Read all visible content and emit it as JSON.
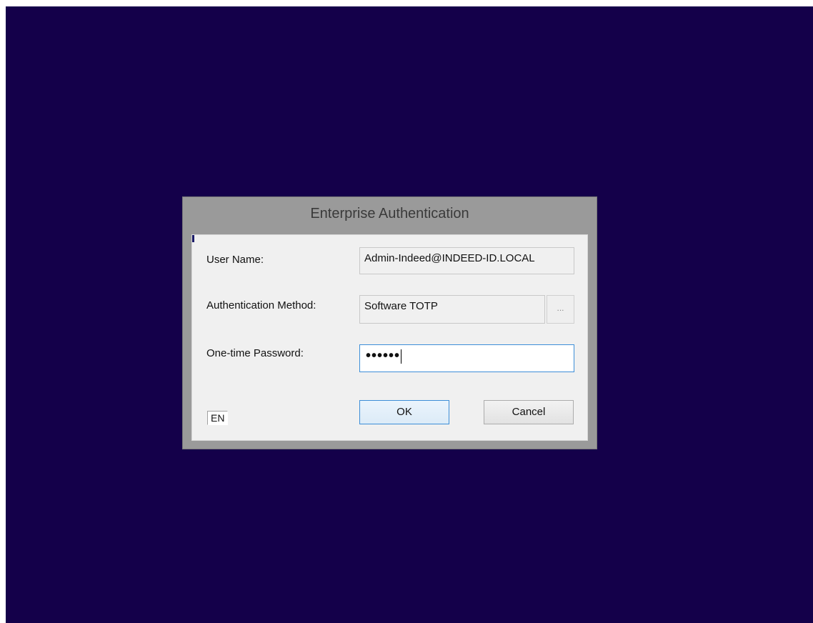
{
  "dialog": {
    "title": "Enterprise Authentication"
  },
  "form": {
    "user_name_label": "User Name:",
    "user_name_value": "Admin-Indeed@INDEED-ID.LOCAL",
    "auth_method_label": "Authentication Method:",
    "auth_method_value": "Software TOTP",
    "browse_button_label": "...",
    "otp_label": "One-time Password:",
    "otp_masked_value": "••••••"
  },
  "buttons": {
    "ok_label": "OK",
    "cancel_label": "Cancel"
  },
  "language_indicator": "EN"
}
